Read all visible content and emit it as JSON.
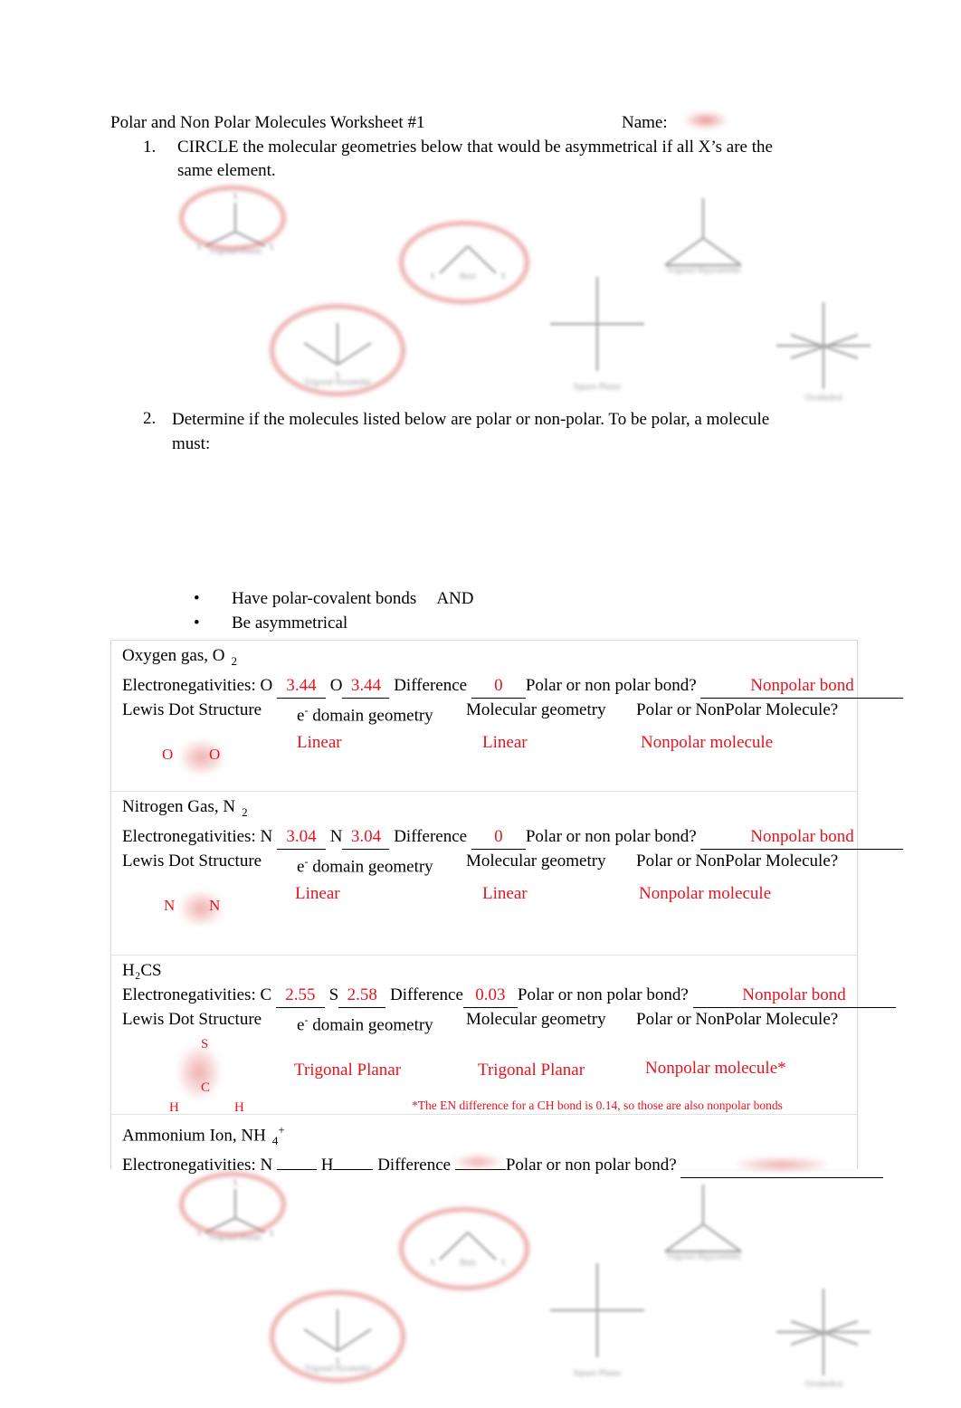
{
  "header": {
    "title": "Polar and Non Polar Molecules Worksheet #1",
    "name_label": "Name:",
    "name_value": ""
  },
  "questions": [
    {
      "number": "1.",
      "text": "CIRCLE the molecular geometries below that would be asymmetrical if all X’s are the same element."
    },
    {
      "number": "2.",
      "text": "Determine if the molecules listed below are polar or non-polar. To be polar, a molecule must:"
    }
  ],
  "bullets": [
    {
      "dot": "•",
      "text": "Have polar-covalent bonds",
      "suffix": "AND"
    },
    {
      "dot": "•",
      "text": "Be asymmetrical",
      "suffix": ""
    }
  ],
  "geometries": [
    {
      "name": "trigonal-planar",
      "label": "Trigonal Planar",
      "circled": true
    },
    {
      "name": "bent",
      "label": "Bent",
      "circled": true
    },
    {
      "name": "trigonal-pyramidal",
      "label": "Trigonal Pyramidal",
      "circled": true
    },
    {
      "name": "square-planar",
      "label": "Square Planar",
      "circled": false
    },
    {
      "name": "trigonal-bipyramidal",
      "label": "Trigonal Bipyramidal",
      "circled": false
    },
    {
      "name": "octahedral",
      "label": "Octahedral",
      "circled": false
    }
  ],
  "table": {
    "column_headers": [
      "Lewis Dot Structure",
      "e- domain geometry",
      "Molecular geometry",
      "Polar or NonPolar Molecule?"
    ],
    "en_prefix": "Electronegativities:",
    "difference_label": "Difference",
    "bond_question": "Polar or non polar bond?",
    "rows": [
      {
        "title": "Oxygen gas, O",
        "subscript": "2",
        "superscript": "",
        "atom1": "O",
        "en1": "3.44",
        "atom2": "O",
        "en2": "3.44",
        "difference": "0",
        "bond_answer": "Nonpolar bond",
        "lewis": {
          "left": "O",
          "right": "O"
        },
        "domain_geometry": "Linear",
        "molecular_geometry": "Linear",
        "polarity": "Nonpolar molecule",
        "footnote": ""
      },
      {
        "title": "Nitrogen Gas, N",
        "subscript": "2",
        "superscript": "",
        "atom1": "N",
        "en1": "3.04",
        "atom2": "N",
        "en2": "3.04",
        "difference": "0",
        "bond_answer": "Nonpolar bond",
        "lewis": {
          "left": "N",
          "right": "N"
        },
        "domain_geometry": "Linear",
        "molecular_geometry": "Linear",
        "polarity": "Nonpolar molecule",
        "footnote": ""
      },
      {
        "title": "H₂CS",
        "subscript": "",
        "superscript": "",
        "atom1": "C",
        "en1": "2.55",
        "atom2": "S",
        "en2": "2.58",
        "difference": "0.03",
        "bond_answer": "Nonpolar bond",
        "lewis": {
          "top": "S",
          "center": "C",
          "bottom_left": "H",
          "bottom_right": "H"
        },
        "domain_geometry": "Trigonal Planar",
        "molecular_geometry": "Trigonal Planar",
        "polarity": "Nonpolar molecule*",
        "footnote": "*The EN difference for a CH bond is 0.14, so those are also nonpolar bonds"
      },
      {
        "title": "Ammonium Ion, NH",
        "subscript": "4",
        "superscript": "+",
        "atom1": "N",
        "en1": "",
        "atom2": "H",
        "en2": "",
        "difference": "",
        "bond_answer": "",
        "lewis": {},
        "domain_geometry": "",
        "molecular_geometry": "",
        "polarity": "",
        "footnote": ""
      }
    ]
  },
  "colors": {
    "answer_red": "#e8131e",
    "circle_red": "#de7878",
    "diagram_gray": "#a8a8a8",
    "text_black": "#000000"
  }
}
